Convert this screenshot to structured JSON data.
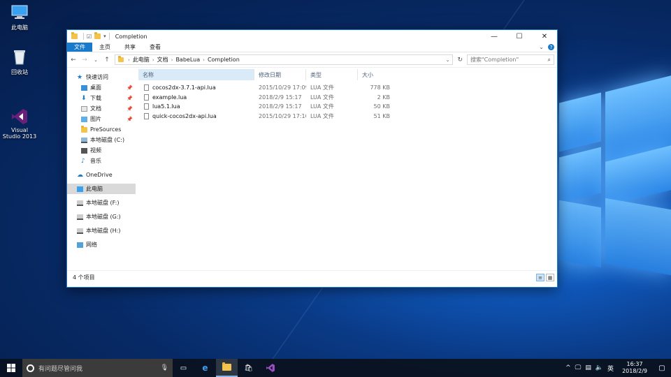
{
  "desktop": {
    "icons": [
      {
        "label": "此电脑",
        "icon": "this-pc-icon"
      },
      {
        "label": "回收站",
        "icon": "recycle-bin-icon"
      },
      {
        "label": "Visual\nStudio 2013",
        "icon": "visual-studio-icon"
      }
    ]
  },
  "window": {
    "title": "Completion",
    "controls": {
      "minimize": "—",
      "maximize": "☐",
      "close": "✕"
    },
    "ribbon_tabs": [
      "文件",
      "主页",
      "共享",
      "查看"
    ],
    "nav_buttons": {
      "back": "←",
      "forward": "→",
      "recent": "⌄",
      "up": "↑"
    },
    "breadcrumb": [
      "此电脑",
      "文档",
      "BabeLua",
      "Completion"
    ],
    "search_placeholder": "搜索\"Completion\"",
    "nav_pane": [
      {
        "label": "快速访问",
        "icon": "star-icon",
        "level": 0
      },
      {
        "label": "桌面",
        "icon": "desktop-folder-icon",
        "level": 1,
        "pinned": true
      },
      {
        "label": "下载",
        "icon": "downloads-icon",
        "level": 1,
        "pinned": true
      },
      {
        "label": "文档",
        "icon": "documents-icon",
        "level": 1,
        "pinned": true
      },
      {
        "label": "图片",
        "icon": "pictures-icon",
        "level": 1,
        "pinned": true
      },
      {
        "label": "PreSources",
        "icon": "folder-icon",
        "level": 1
      },
      {
        "label": "本地磁盘 (C:)",
        "icon": "drive-icon",
        "level": 1
      },
      {
        "label": "视频",
        "icon": "videos-icon",
        "level": 1
      },
      {
        "label": "音乐",
        "icon": "music-icon",
        "level": 1
      },
      {
        "label": "OneDrive",
        "icon": "onedrive-icon",
        "level": 0
      },
      {
        "label": "此电脑",
        "icon": "this-pc-icon",
        "level": 0,
        "selected": true
      },
      {
        "label": "本地磁盘 (F:)",
        "icon": "drive-icon",
        "level": 0
      },
      {
        "label": "本地磁盘 (G:)",
        "icon": "drive-icon",
        "level": 0
      },
      {
        "label": "本地磁盘 (H:)",
        "icon": "drive-icon",
        "level": 0
      },
      {
        "label": "网络",
        "icon": "network-icon",
        "level": 0
      }
    ],
    "columns": {
      "name": "名称",
      "date": "修改日期",
      "type": "类型",
      "size": "大小"
    },
    "files": [
      {
        "name": "cocos2dx-3.7.1-api.lua",
        "date": "2015/10/29 17:09",
        "type": "LUA 文件",
        "size": "778 KB"
      },
      {
        "name": "example.lua",
        "date": "2018/2/9 15:17",
        "type": "LUA 文件",
        "size": "2 KB"
      },
      {
        "name": "lua5.1.lua",
        "date": "2018/2/9 15:17",
        "type": "LUA 文件",
        "size": "50 KB"
      },
      {
        "name": "quick-cocos2dx-api.lua",
        "date": "2015/10/29 17:10",
        "type": "LUA 文件",
        "size": "51 KB"
      }
    ],
    "status": "4 个项目"
  },
  "taskbar": {
    "search_placeholder": "有问题尽管问我",
    "apps": [
      "task-view-icon",
      "edge-icon",
      "file-explorer-icon",
      "store-icon",
      "visual-studio-icon"
    ],
    "ime": "英",
    "time": "16:37",
    "date": "2018/2/9"
  },
  "colors": {
    "accent": "#1979ca",
    "taskbar": "#0a1220"
  }
}
